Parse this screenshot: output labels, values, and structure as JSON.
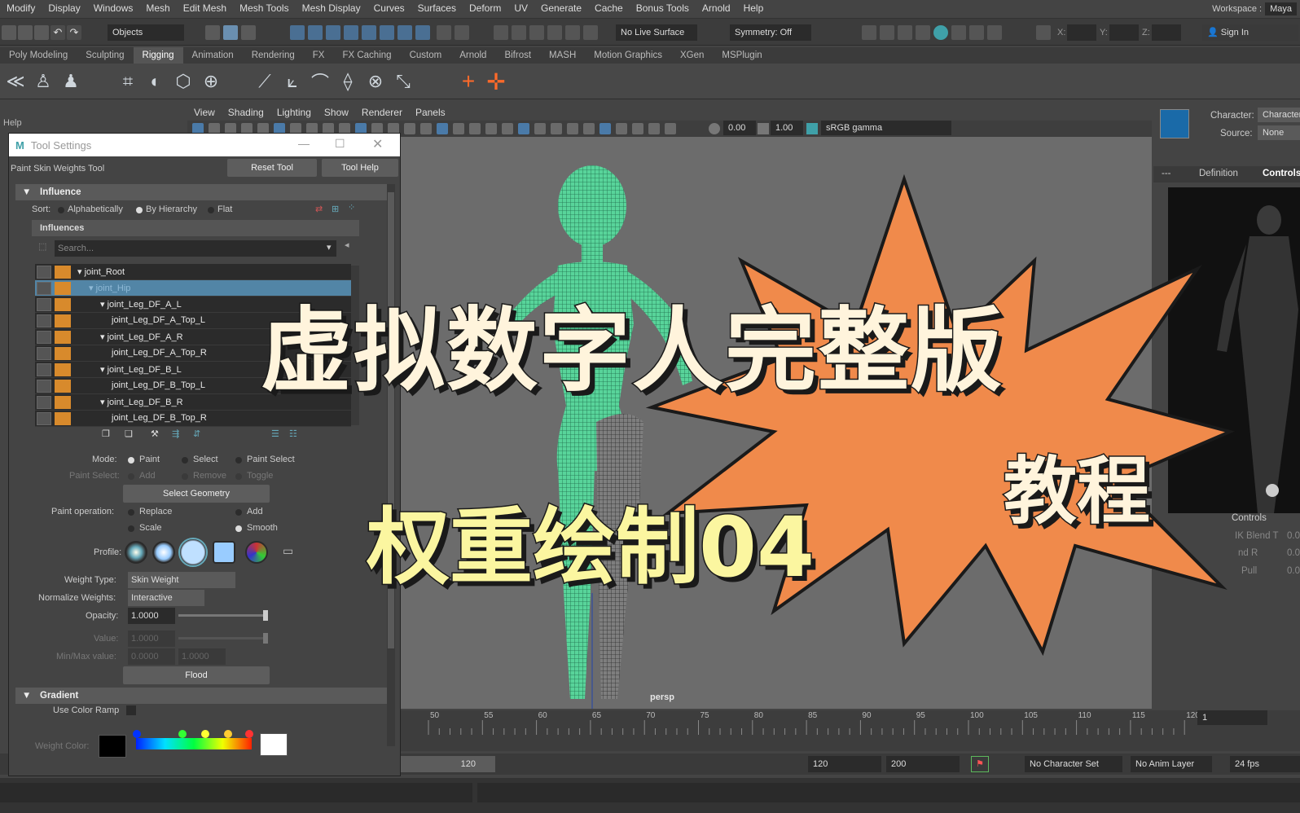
{
  "menubar": {
    "items": [
      "Modify",
      "Display",
      "Windows",
      "Mesh",
      "Edit Mesh",
      "Mesh Tools",
      "Mesh Display",
      "Curves",
      "Surfaces",
      "Deform",
      "UV",
      "Generate",
      "Cache",
      "Bonus Tools",
      "Arnold",
      "Help"
    ],
    "workspace_label": "Workspace :",
    "workspace_value": "Maya"
  },
  "statusline": {
    "objects_field": "Objects",
    "live_surface": "No Live Surface",
    "symmetry": "Symmetry: Off",
    "x_label": "X:",
    "y_label": "Y:",
    "z_label": "Z:",
    "sign_in": "Sign In"
  },
  "shelf": {
    "tabs": [
      "Poly Modeling",
      "Sculpting",
      "Rigging",
      "Animation",
      "Rendering",
      "FX",
      "FX Caching",
      "Custom",
      "Arnold",
      "Bifrost",
      "MASH",
      "Motion Graphics",
      "XGen",
      "MSPlugin"
    ],
    "active_tab": "Rigging"
  },
  "help_label": "Help",
  "viewport": {
    "menus": [
      "View",
      "Shading",
      "Lighting",
      "Show",
      "Renderer",
      "Panels"
    ],
    "exposure": "0.00",
    "gamma": "1.00",
    "color_space": "sRGB gamma",
    "camera_label": "persp"
  },
  "right_panel": {
    "character_label": "Character:",
    "character_value": "Character",
    "source_label": "Source:",
    "source_value": "None",
    "tabs": [
      "---",
      "Definition",
      "Controls"
    ],
    "controls_label": "Controls",
    "rows": [
      "IK Blend T",
      "nd R",
      "Pull"
    ],
    "row_values": [
      "0.0",
      "0.0",
      "0.0"
    ]
  },
  "tool_settings": {
    "window_title": "Tool Settings",
    "tool_name": "Paint Skin Weights Tool",
    "reset_button": "Reset Tool",
    "help_button": "Tool Help",
    "influence_section": "Influence",
    "sort_label": "Sort:",
    "sort_options": [
      "Alphabetically",
      "By Hierarchy",
      "Flat"
    ],
    "influences_header": "Influences",
    "search_placeholder": "Search...",
    "influences": [
      {
        "name": "joint_Root",
        "indent": 0,
        "expand": true
      },
      {
        "name": "joint_Hip",
        "indent": 1,
        "expand": true,
        "selected": true
      },
      {
        "name": "joint_Leg_DF_A_L",
        "indent": 2,
        "expand": true
      },
      {
        "name": "joint_Leg_DF_A_Top_L",
        "indent": 3,
        "expand": false
      },
      {
        "name": "joint_Leg_DF_A_R",
        "indent": 2,
        "expand": true
      },
      {
        "name": "joint_Leg_DF_A_Top_R",
        "indent": 3,
        "expand": false
      },
      {
        "name": "joint_Leg_DF_B_L",
        "indent": 2,
        "expand": true
      },
      {
        "name": "joint_Leg_DF_B_Top_L",
        "indent": 3,
        "expand": false
      },
      {
        "name": "joint_Leg_DF_B_R",
        "indent": 2,
        "expand": true
      },
      {
        "name": "joint_Leg_DF_B_Top_R",
        "indent": 3,
        "expand": false
      }
    ],
    "mode_label": "Mode:",
    "mode_options": [
      "Paint",
      "Select",
      "Paint Select"
    ],
    "paint_select_label": "Paint Select:",
    "paint_select_options": [
      "Add",
      "Remove",
      "Toggle"
    ],
    "select_geometry_button": "Select Geometry",
    "paint_operation_label": "Paint operation:",
    "paint_operation_options": [
      "Replace",
      "Add",
      "Scale",
      "Smooth"
    ],
    "profile_label": "Profile:",
    "weight_type_label": "Weight Type:",
    "weight_type_value": "Skin Weight",
    "normalize_label": "Normalize Weights:",
    "normalize_value": "Interactive",
    "opacity_label": "Opacity:",
    "opacity_value": "1.0000",
    "value_label": "Value:",
    "value_value": "1.0000",
    "minmax_label": "Min/Max value:",
    "min_value": "0.0000",
    "max_value": "1.0000",
    "flood_button": "Flood",
    "gradient_section": "Gradient",
    "use_color_ramp_label": "Use Color Ramp",
    "weight_color_label": "Weight Color:"
  },
  "timeline": {
    "ticks": [
      "50",
      "55",
      "60",
      "65",
      "70",
      "75",
      "80",
      "85",
      "90",
      "95",
      "100",
      "105",
      "110",
      "115",
      "120"
    ],
    "current_frame": "1"
  },
  "range": {
    "range_end": "120",
    "anim_end": "120",
    "max_end": "200",
    "character_set": "No Character Set",
    "anim_layer": "No Anim Layer",
    "fps": "24 fps"
  },
  "overlay": {
    "title_line1": "虚拟数字人完整版",
    "title_line2": "教程",
    "subtitle": "权重绘制04",
    "burst_color": "#f08a4b",
    "title_color": "#fff4dc",
    "subtitle_color": "#fbf6a0"
  }
}
